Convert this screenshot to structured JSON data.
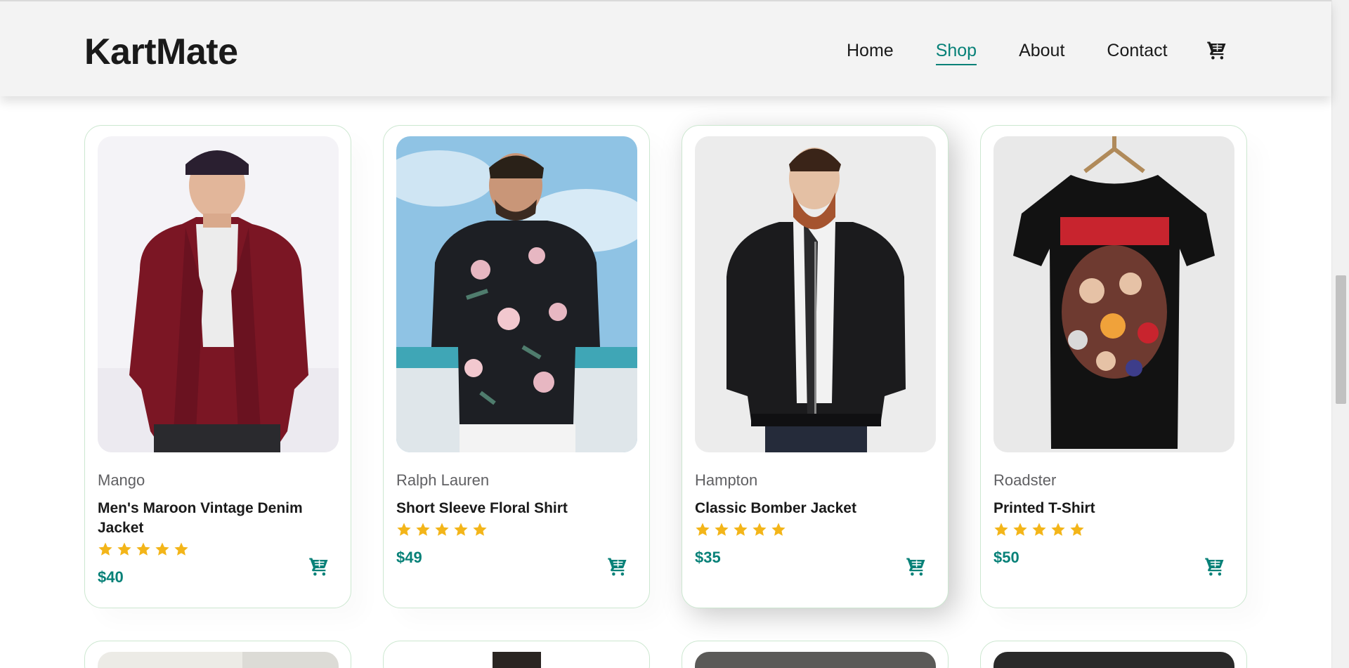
{
  "header": {
    "logo": "KartMate",
    "nav": [
      {
        "label": "Home",
        "active": false
      },
      {
        "label": "Shop",
        "active": true
      },
      {
        "label": "About",
        "active": false
      },
      {
        "label": "Contact",
        "active": false
      }
    ],
    "cart_icon": "cart-icon"
  },
  "colors": {
    "accent": "#088178",
    "star": "#f3b519",
    "header_bg": "#f3f3f3",
    "card_border": "#cce7d0"
  },
  "products": [
    {
      "brand": "Mango",
      "name": "Men's Maroon Vintage Denim Jacket",
      "rating": 5,
      "price": "$40",
      "image": "maroon-denim-jacket-photo"
    },
    {
      "brand": "Ralph Lauren",
      "name": "Short Sleeve Floral Shirt",
      "rating": 5,
      "price": "$49",
      "image": "floral-shirt-photo"
    },
    {
      "brand": "Hampton",
      "name": "Classic Bomber Jacket",
      "rating": 5,
      "price": "$35",
      "image": "bomber-jacket-photo"
    },
    {
      "brand": "Roadster",
      "name": "Printed T-Shirt",
      "rating": 5,
      "price": "$50",
      "image": "printed-tshirt-photo"
    }
  ]
}
